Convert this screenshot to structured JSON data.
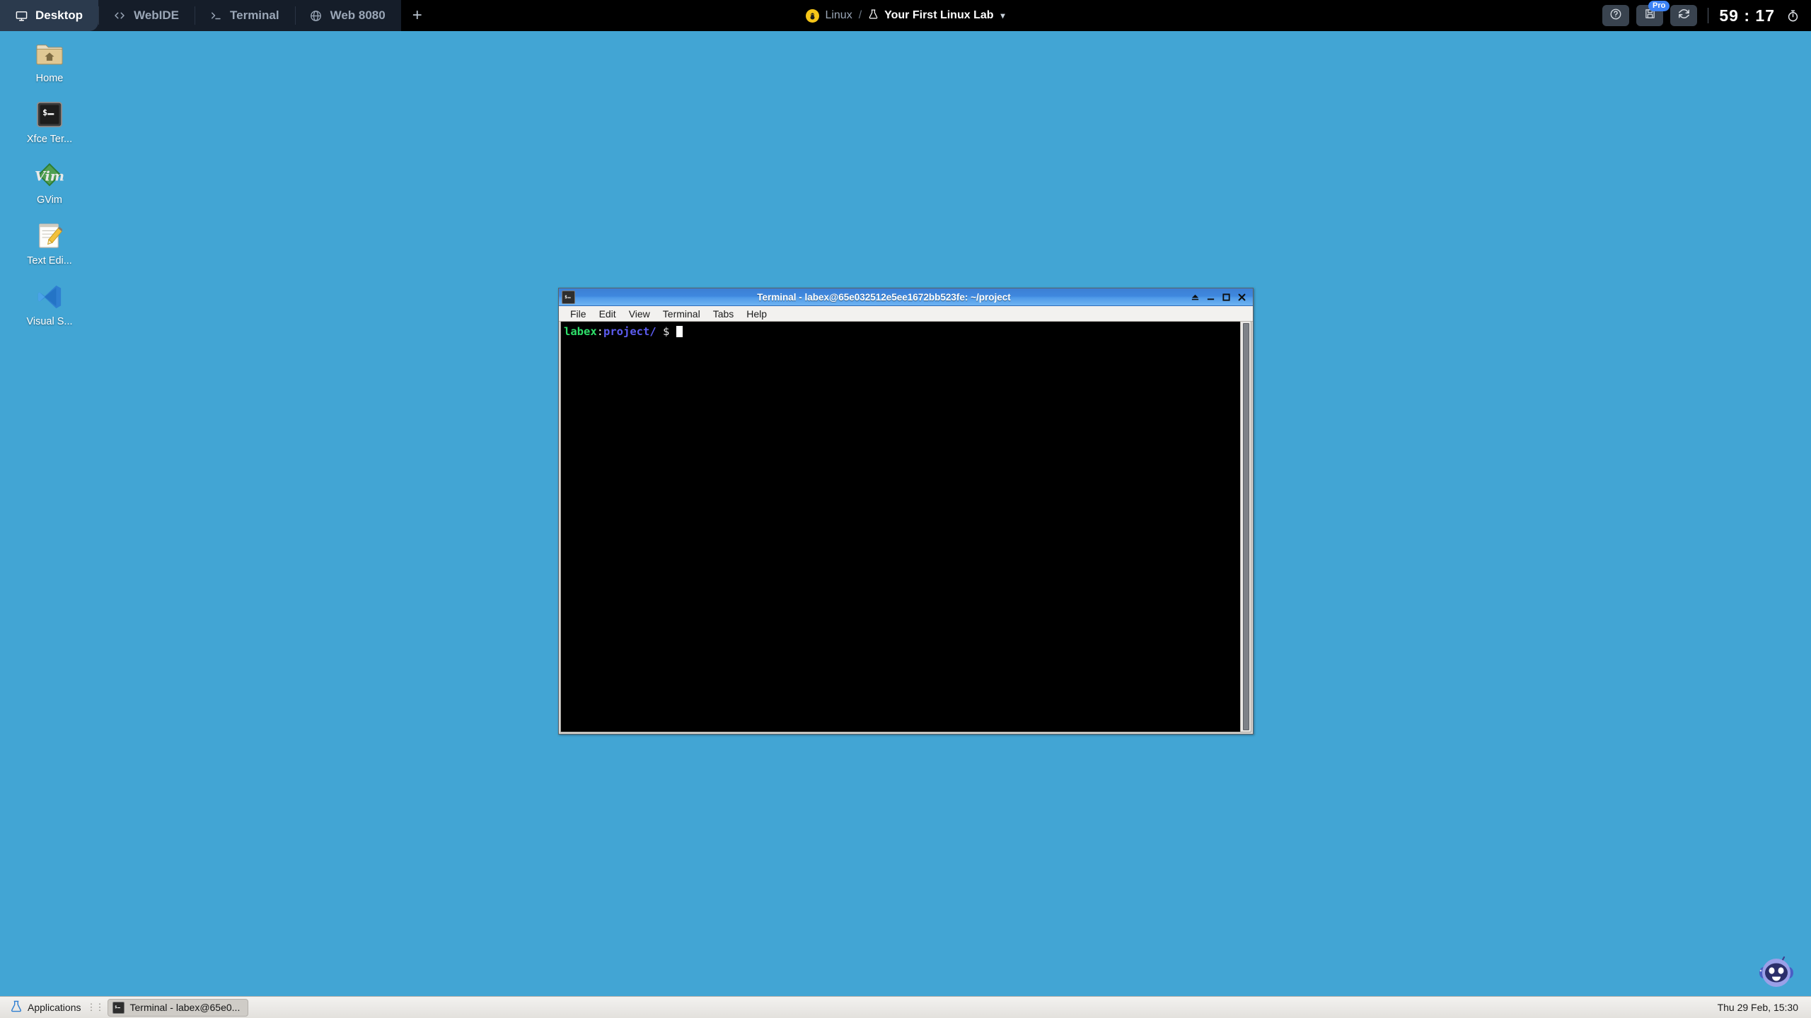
{
  "topbar": {
    "tabs": [
      {
        "label": "Desktop",
        "icon": "monitor-icon",
        "active": true
      },
      {
        "label": "WebIDE",
        "icon": "code-brackets-icon",
        "active": false
      },
      {
        "label": "Terminal",
        "icon": "prompt-icon",
        "active": false
      },
      {
        "label": "Web 8080",
        "icon": "globe-icon",
        "active": false
      }
    ],
    "add_tab_label": "+",
    "breadcrumb": {
      "os": "Linux",
      "separator": "/",
      "lab": "Your First Linux Lab",
      "chevron": "▾"
    },
    "actions": {
      "help_label": "help-icon",
      "save_label": "save-icon",
      "save_badge": "Pro",
      "refresh_label": "refresh-icon"
    },
    "timer": "59 : 17"
  },
  "desktop": {
    "background_color": "#42a5d4",
    "icons": [
      {
        "label": "Home",
        "icon": "home-folder-icon"
      },
      {
        "label": "Xfce Ter...",
        "icon": "terminal-icon"
      },
      {
        "label": "GVim",
        "icon": "gvim-icon"
      },
      {
        "label": "Text Edi...",
        "icon": "text-editor-icon"
      },
      {
        "label": "Visual S...",
        "icon": "vscode-icon"
      }
    ]
  },
  "terminal_window": {
    "title": "Terminal - labex@65e032512e5ee1672bb523fe: ~/project",
    "icon": "terminal-icon",
    "controls": {
      "shade": "shade-icon",
      "minimize": "minimize-icon",
      "maximize": "maximize-icon",
      "close": "close-icon"
    },
    "menu": [
      "File",
      "Edit",
      "View",
      "Terminal",
      "Tabs",
      "Help"
    ],
    "prompt": {
      "user": "labex",
      "colon": ":",
      "path": "project/",
      "dollar": "$"
    },
    "colors": {
      "background": "#000000",
      "user_color": "#2ee06a",
      "path_color": "#5c5cf0",
      "text_color": "#e8e8e8",
      "titlebar_color": "#3f88de"
    }
  },
  "assistant": {
    "label": "robot-assistant-icon"
  },
  "taskbar": {
    "applications_label": "Applications",
    "handle": "⋮⋮",
    "windows": [
      {
        "label": "Terminal - labex@65e0...",
        "icon": "terminal-icon"
      }
    ],
    "clock": "Thu 29 Feb, 15:30"
  }
}
